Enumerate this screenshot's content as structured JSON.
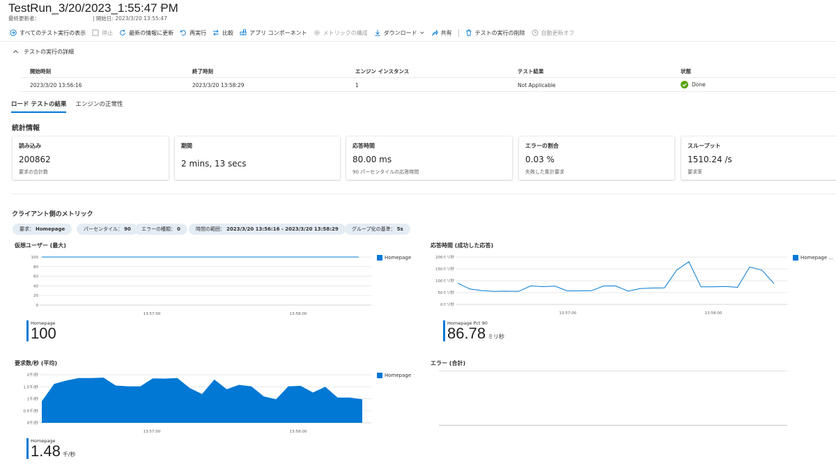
{
  "header": {
    "title": "TestRun_3/20/2023_1:55:47 PM",
    "more": "···",
    "updated_by": "最終更新者：",
    "start_date": "| 開始日: 2023/3/20 13:55:47"
  },
  "toolbar": {
    "items": [
      {
        "label": "すべてのテスト実行の表示",
        "icon": "arrow-right-circle-icon"
      },
      {
        "label": "停止",
        "icon": "stop-icon"
      },
      {
        "label": "最新の情報に更新",
        "icon": "refresh-icon"
      },
      {
        "label": "再実行",
        "icon": "rerun-icon"
      },
      {
        "label": "比較",
        "icon": "compare-icon"
      },
      {
        "label": "アプリ コンポーネント",
        "icon": "app-components-icon"
      },
      {
        "label": "メトリックの構成",
        "icon": "gear-icon"
      },
      {
        "label": "ダウンロード",
        "icon": "download-icon"
      },
      {
        "label": "共有",
        "icon": "share-icon"
      },
      {
        "label": "テストの実行の削除",
        "icon": "trash-icon"
      },
      {
        "label": "自動更新オフ",
        "icon": "clock-icon"
      }
    ]
  },
  "details": {
    "title": "テストの実行の詳細",
    "headers": [
      "開始時刻",
      "終了時刻",
      "エンジン インスタンス",
      "テスト結果",
      "状態"
    ],
    "row": [
      "2023/3/20 13:56:16",
      "2023/3/20 13:58:29",
      "1",
      "Not Applicable",
      "Done"
    ],
    "status_color": "#57a300"
  },
  "tabs": [
    "ロード テストの結果",
    "エンジンの正常性"
  ],
  "stats": {
    "title": "統計情報",
    "cards": [
      {
        "title": "読み込み",
        "value": "200862",
        "sub": "要求の合計数"
      },
      {
        "title": "期間",
        "value": "2 mins, 13 secs",
        "sub": ""
      },
      {
        "title": "応答時間",
        "value": "80.00 ms",
        "sub": "90 パーセンタイルの応答時間"
      },
      {
        "title": "エラーの割合",
        "value": "0.03 %",
        "sub": "失敗した集計要求"
      },
      {
        "title": "スループット",
        "value": "1510.24 /s",
        "sub": "要求率"
      }
    ]
  },
  "client_metrics": {
    "title": "クライアント側のメトリック",
    "filters": [
      {
        "label": "要求：",
        "value": "Homepage"
      },
      {
        "label": "パーセンタイル：",
        "value": "90"
      },
      {
        "label": "エラーの種類：",
        "value": "0"
      },
      {
        "label": "時間の範囲：",
        "value": "2023/3/20 13:56:16 - 2023/3/20 13:58:29"
      },
      {
        "label": "グループ化の基準：",
        "value": "5s"
      }
    ]
  },
  "accent": "#0078d4",
  "charts": {
    "vu": {
      "summary_label": "Homepage",
      "summary_value": "100",
      "summary_unit": ""
    },
    "rt": {
      "summary_label": "Homepage Pct 90",
      "summary_value": "86.78",
      "summary_unit": "ミリ秒"
    },
    "rps": {
      "summary_label": "Homepage",
      "summary_value": "1.48",
      "summary_unit": "千/秒"
    },
    "err": {}
  },
  "chart_data": [
    {
      "type": "line",
      "title": "仮想ユーザー (最大)",
      "xticks": [
        "13:57:00",
        "13:58:00"
      ],
      "yticks": [
        "0",
        "20",
        "40",
        "60",
        "80",
        "100"
      ],
      "ylim": [
        0,
        100
      ],
      "series": [
        {
          "name": "Homepage",
          "values": [
            100,
            100,
            100,
            100,
            100,
            100,
            100,
            100,
            100,
            100,
            100,
            100,
            100,
            100,
            100,
            100,
            100,
            100,
            100,
            100,
            100,
            100,
            100,
            100,
            100,
            100,
            100
          ]
        }
      ]
    },
    {
      "type": "line",
      "title": "応答時間 (成功した応答)",
      "xticks": [
        "13:57:00",
        "13:58:00"
      ],
      "yticks": [
        "0ミリ秒",
        "50ミリ秒",
        "100ミリ秒",
        "150ミリ秒",
        "200ミリ秒"
      ],
      "ylim": [
        0,
        200
      ],
      "series": [
        {
          "name": "Homepage ...",
          "values": [
            90,
            65,
            58,
            55,
            56,
            55,
            78,
            75,
            77,
            57,
            57,
            58,
            78,
            78,
            56,
            67,
            69,
            70,
            145,
            180,
            74,
            74,
            76,
            72,
            158,
            145,
            88
          ]
        }
      ]
    },
    {
      "type": "area",
      "title": "要求数/秒 (平均)",
      "xticks": [
        "13:57:00",
        "13:58:00"
      ],
      "yticks": [
        "0千/秒",
        "0.5千/秒",
        "1千/秒",
        "1.5千/秒",
        "2千/秒"
      ],
      "ylim": [
        0,
        2
      ],
      "series": [
        {
          "name": "Homepage",
          "values": [
            0.9,
            1.62,
            1.76,
            1.86,
            1.86,
            1.88,
            1.55,
            1.52,
            1.52,
            1.85,
            1.84,
            1.86,
            1.45,
            1.2,
            1.8,
            1.4,
            1.58,
            1.52,
            1.1,
            0.98,
            1.52,
            1.54,
            1.26,
            1.5,
            1.05,
            1.05,
            0.98
          ]
        }
      ]
    },
    {
      "type": "line",
      "title": "エラー (合計)",
      "series": []
    }
  ]
}
